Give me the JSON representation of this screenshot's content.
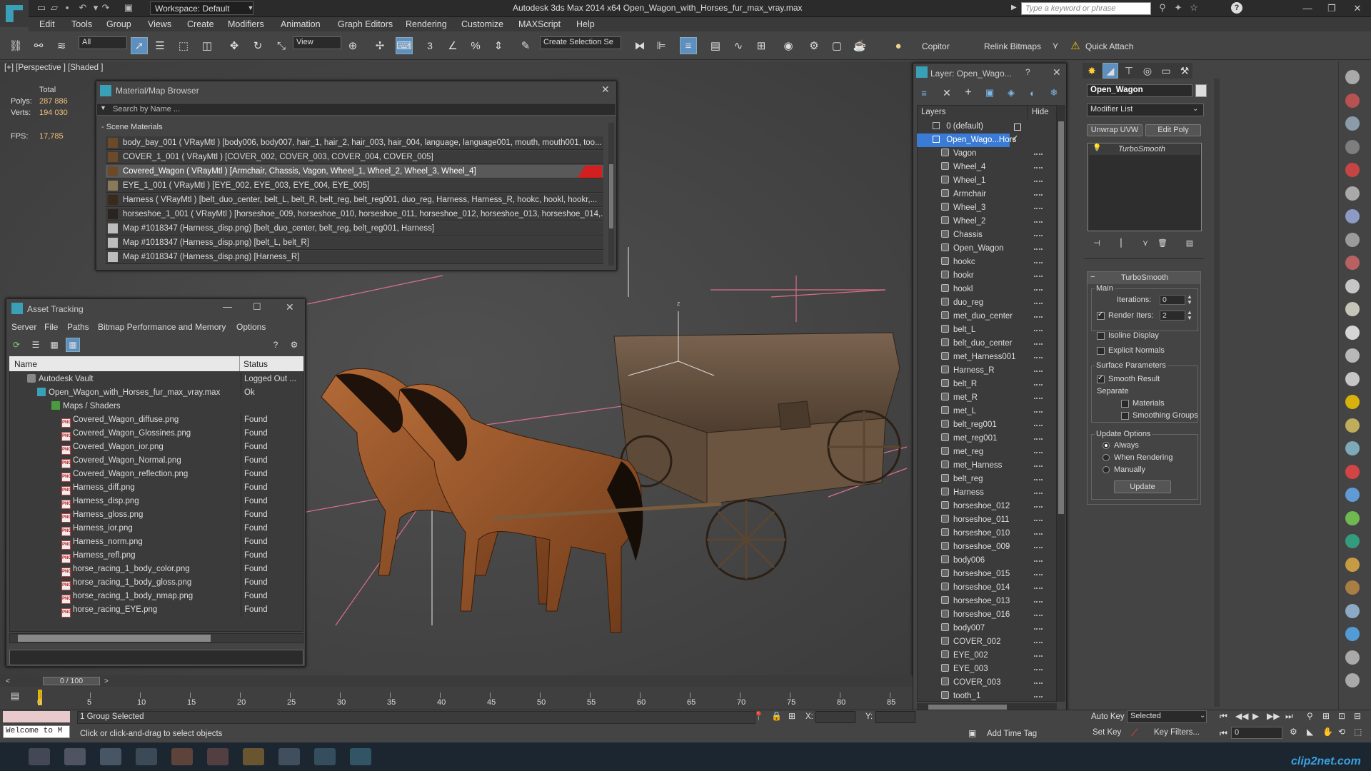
{
  "titlebar": {
    "workspace": "Workspace: Default",
    "app_title": "Autodesk 3ds Max  2014 x64     Open_Wagon_with_Horses_fur_max_vray.max",
    "search_placeholder": "Type a keyword or phrase"
  },
  "menu": [
    "Edit",
    "Tools",
    "Group",
    "Views",
    "Create",
    "Modifiers",
    "Animation",
    "Graph Editors",
    "Rendering",
    "Customize",
    "MAXScript",
    "Help"
  ],
  "toolbar": {
    "filter": "All",
    "ref_coord": "View",
    "selection_set": "Create Selection Se",
    "copitor": "Copitor",
    "relink": "Relink Bitmaps",
    "quick_attach": "Quick Attach",
    "snap_label": "3"
  },
  "viewport": {
    "label": "[+] [Perspective ] [Shaded ]",
    "stats": {
      "total_label": "Total",
      "polys_label": "Polys:",
      "polys": "287 886",
      "verts_label": "Verts:",
      "verts": "194 030",
      "fps_label": "FPS:",
      "fps": "17,785"
    },
    "gizmo_label": "z"
  },
  "material_browser": {
    "title": "Material/Map Browser",
    "search_placeholder": "Search by Name ...",
    "group": "- Scene Materials",
    "rows": [
      "body_bay_001  ( VRayMtl )  [body006, body007, hair_1, hair_2, hair_003, hair_004, language, language001, mouth, mouth001, too...",
      "COVER_1_001  ( VRayMtl )  [COVER_002, COVER_003, COVER_004, COVER_005]",
      "Covered_Wagon  ( VRayMtl )  [Armchair, Chassis, Vagon, Wheel_1, Wheel_2, Wheel_3, Wheel_4]",
      "EYE_1_001  ( VRayMtl )  [EYE_002, EYE_003, EYE_004, EYE_005]",
      "Harness  ( VRayMtl )  [belt_duo_center, belt_L, belt_R, belt_reg, belt_reg001, duo_reg, Harness, Harness_R, hookc, hookl, hookr,...",
      "horseshoe_1_001  ( VRayMtl )  [horseshoe_009, horseshoe_010, horseshoe_011, horseshoe_012, horseshoe_013, horseshoe_014,...",
      "Map #1018347 (Harness_disp.png)  [belt_duo_center, belt_reg, belt_reg001, Harness]",
      "Map #1018347 (Harness_disp.png)  [belt_L, belt_R]",
      "Map #1018347 (Harness_disp.png)  [Harness_R]"
    ]
  },
  "asset_tracking": {
    "title": "Asset Tracking",
    "menu": [
      "Server",
      "File",
      "Paths",
      "Bitmap Performance and Memory",
      "Options"
    ],
    "col_name": "Name",
    "col_status": "Status",
    "vault": {
      "name": "Autodesk Vault",
      "status": "Logged Out ..."
    },
    "file": {
      "name": "Open_Wagon_with_Horses_fur_max_vray.max",
      "status": "Ok"
    },
    "folder": "Maps / Shaders",
    "maps": [
      {
        "name": "Covered_Wagon_diffuse.png",
        "status": "Found"
      },
      {
        "name": "Covered_Wagon_Glossines.png",
        "status": "Found"
      },
      {
        "name": "Covered_Wagon_ior.png",
        "status": "Found"
      },
      {
        "name": "Covered_Wagon_Normal.png",
        "status": "Found"
      },
      {
        "name": "Covered_Wagon_reflection.png",
        "status": "Found"
      },
      {
        "name": "Harness_diff.png",
        "status": "Found"
      },
      {
        "name": "Harness_disp.png",
        "status": "Found"
      },
      {
        "name": "Harness_gloss.png",
        "status": "Found"
      },
      {
        "name": "Harness_ior.png",
        "status": "Found"
      },
      {
        "name": "Harness_norm.png",
        "status": "Found"
      },
      {
        "name": "Harness_refl.png",
        "status": "Found"
      },
      {
        "name": "horse_racing_1_body_color.png",
        "status": "Found"
      },
      {
        "name": "horse_racing_1_body_gloss.png",
        "status": "Found"
      },
      {
        "name": "horse_racing_1_body_nmap.png",
        "status": "Found"
      },
      {
        "name": "horse_racing_EYE.png",
        "status": "Found"
      }
    ]
  },
  "layer_panel": {
    "title": "Layer: Open_Wago...",
    "col_layers": "Layers",
    "col_hide": "Hide",
    "default_layer": "0 (default)",
    "active_layer": "Open_Wago...Hors",
    "objects": [
      "Vagon",
      "Wheel_4",
      "Wheel_1",
      "Armchair",
      "Wheel_3",
      "Wheel_2",
      "Chassis",
      "Open_Wagon",
      "hookc",
      "hookr",
      "hookl",
      "duo_reg",
      "met_duo_center",
      "belt_L",
      "belt_duo_center",
      "met_Harness001",
      "Harness_R",
      "belt_R",
      "met_R",
      "met_L",
      "belt_reg001",
      "met_reg001",
      "met_reg",
      "met_Harness",
      "belt_reg",
      "Harness",
      "horseshoe_012",
      "horseshoe_011",
      "horseshoe_010",
      "horseshoe_009",
      "body006",
      "horseshoe_015",
      "horseshoe_014",
      "horseshoe_013",
      "horseshoe_016",
      "body007",
      "COVER_002",
      "EYE_002",
      "EYE_003",
      "COVER_003",
      "tooth_1"
    ]
  },
  "command_panel": {
    "object_name": "Open_Wagon",
    "modifier_list": "Modifier List",
    "btn_unwrap": "Unwrap UVW",
    "btn_editpoly": "Edit Poly",
    "stack_item": "TurboSmooth",
    "rollout_title": "TurboSmooth",
    "main_label": "Main",
    "iterations_label": "Iterations:",
    "iterations": "0",
    "render_iters_label": "Render Iters:",
    "render_iters": "2",
    "isoline": "Isoline Display",
    "explicit": "Explicit Normals",
    "surface_params": "Surface Parameters",
    "smooth_result": "Smooth Result",
    "separate": "Separate",
    "materials": "Materials",
    "smoothing_groups": "Smoothing Groups",
    "update_options": "Update Options",
    "always": "Always",
    "when_rendering": "When Rendering",
    "manually": "Manually",
    "update_btn": "Update"
  },
  "timeline": {
    "frame": "0 / 100",
    "ticks": [
      "0",
      "5",
      "10",
      "15",
      "20",
      "25",
      "30",
      "35",
      "40",
      "45",
      "50",
      "55",
      "60",
      "65",
      "70",
      "75",
      "80",
      "85"
    ]
  },
  "statusbar": {
    "maxscript": "Welcome to M",
    "selection": "1 Group Selected",
    "prompt": "Click or click-and-drag to select objects",
    "x_label": "X:",
    "y_label": "Y:",
    "add_time_tag": "Add Time Tag",
    "auto_key": "Auto Key",
    "selected": "Selected",
    "set_key": "Set Key",
    "key_filters": "Key Filters...",
    "frame_field": "0"
  },
  "watermark": "clip2net.com",
  "colors": {
    "accent_blue": "#5d8fbf",
    "material_highlight": "#d21f1f",
    "viewport_bg": "#4a4a4a",
    "grid_pink": "#e0708a"
  }
}
